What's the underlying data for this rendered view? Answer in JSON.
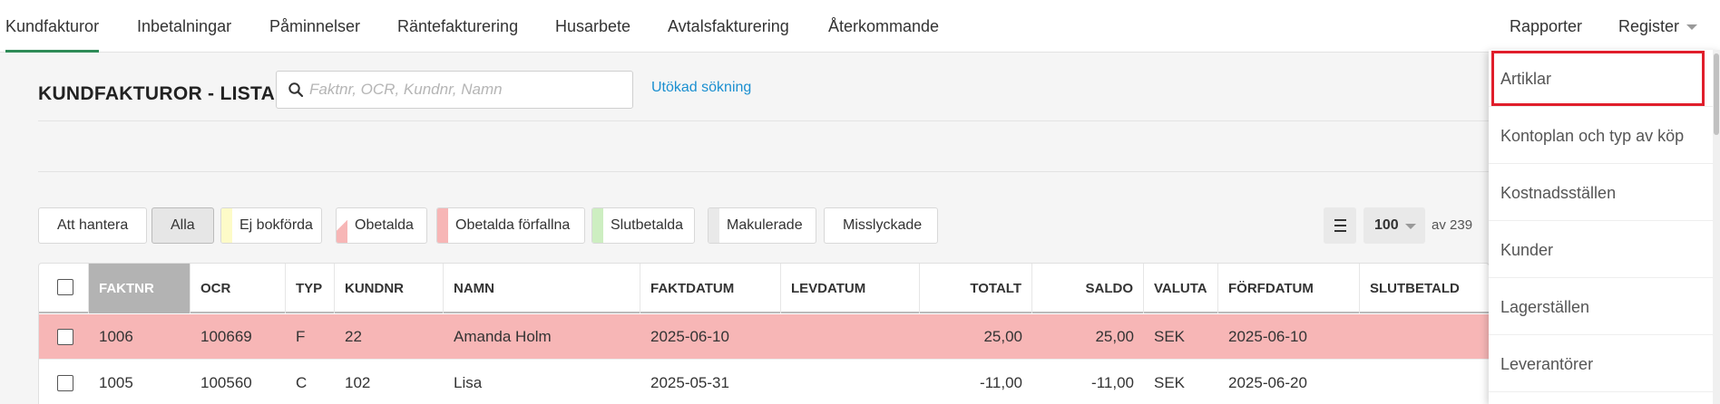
{
  "nav": {
    "tabs": [
      "Kundfakturor",
      "Inbetalningar",
      "Påminnelser",
      "Räntefakturering",
      "Husarbete",
      "Avtalsfakturering",
      "Återkommande"
    ],
    "active_tab": "Kundfakturor",
    "right": [
      "Rapporter",
      "Register"
    ]
  },
  "header": {
    "title": "KUNDFAKTUROR - LISTA",
    "search_placeholder": "Faktnr, OCR, Kundnr, Namn",
    "advanced_search": "Utökad sökning"
  },
  "filters": [
    {
      "label": "Att hantera",
      "color": ""
    },
    {
      "label": "Alla",
      "color": "",
      "active": true
    },
    {
      "label": "Ej bokförda",
      "color": "#fdfbc8"
    },
    {
      "label": "Obetalda",
      "color": "#f7b6b6",
      "half": true
    },
    {
      "label": "Obetalda förfallna",
      "color": "#f7b6b6"
    },
    {
      "label": "Slutbetalda",
      "color": "#cdeec1"
    },
    {
      "label": "Makulerade",
      "color": "#e9e9e9"
    },
    {
      "label": "Misslyckade",
      "color": ""
    }
  ],
  "pagination": {
    "page_size": "100",
    "total": "av 239"
  },
  "table": {
    "columns": [
      "FAKTNR",
      "OCR",
      "TYP",
      "KUNDNR",
      "NAMN",
      "FAKTDATUM",
      "LEVDATUM",
      "TOTALT",
      "SALDO",
      "VALUTA",
      "FÖRFDATUM",
      "SLUTBETALD"
    ],
    "sorted_column": "FAKTNR",
    "rows": [
      {
        "faktnr": "1006",
        "ocr": "100669",
        "typ": "F",
        "kundnr": "22",
        "namn": "Amanda Holm",
        "faktdatum": "2025-06-10",
        "levdatum": "",
        "totalt": "25,00",
        "saldo": "25,00",
        "valuta": "SEK",
        "forfdatum": "2025-06-10",
        "slutbetald": "",
        "status": "overdue"
      },
      {
        "faktnr": "1005",
        "ocr": "100560",
        "typ": "C",
        "kundnr": "102",
        "namn": "Lisa",
        "faktdatum": "2025-05-31",
        "levdatum": "",
        "totalt": "-11,00",
        "saldo": "-11,00",
        "valuta": "SEK",
        "forfdatum": "2025-06-20",
        "slutbetald": "",
        "status": "normal"
      }
    ]
  },
  "register_menu": {
    "items": [
      "Artiklar",
      "Kontoplan och typ av köp",
      "Kostnadsställen",
      "Kunder",
      "Lagerställen",
      "Leverantörer"
    ],
    "highlighted": "Artiklar"
  },
  "colors": {
    "accent": "#2e8b57",
    "link": "#1a8fd0",
    "highlight_box": "#e01e2b",
    "overdue_row": "#f7b6b6"
  }
}
